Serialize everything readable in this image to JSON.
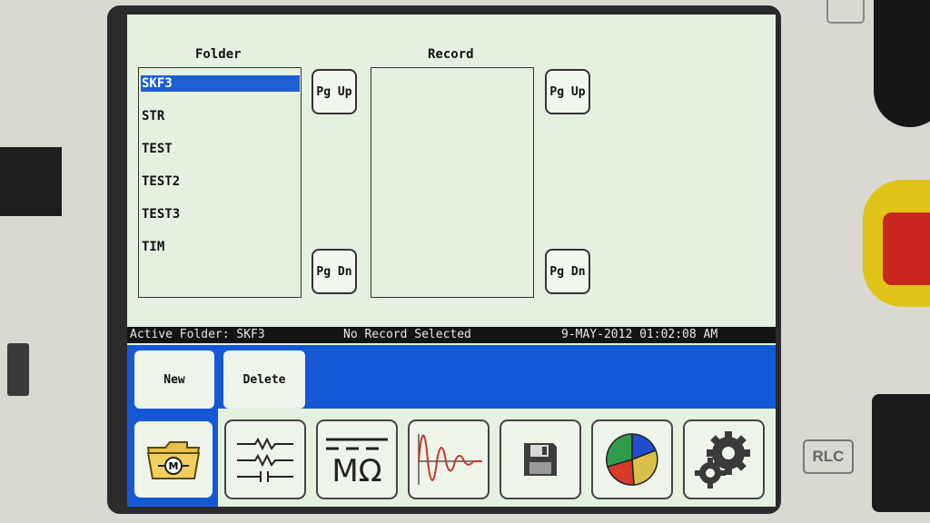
{
  "folder_panel": {
    "title": "Folder",
    "items": [
      "SKF3",
      "STR",
      "TEST",
      "TEST2",
      "TEST3",
      "TIM"
    ],
    "selected": "SKF3"
  },
  "record_panel": {
    "title": "Record"
  },
  "paging": {
    "up_label": "Pg Up",
    "down_label": "Pg Dn"
  },
  "status": {
    "active_folder": "Active Folder: SKF3",
    "record": "No Record Selected",
    "datetime": "9-MAY-2012 01:02:08 AM"
  },
  "actions": {
    "new_label": "New",
    "delete_label": "Delete"
  },
  "nav": {
    "items": [
      "folder-motor-icon",
      "resistor-network-icon",
      "megohm-icon",
      "damped-waveform-icon",
      "floppy-disk-icon",
      "pie-chart-icon",
      "gears-icon"
    ],
    "megohm_text": "MΩ"
  },
  "device": {
    "side_label": "RLC"
  },
  "colors": {
    "accent": "#1558d6",
    "screen": "#e4f1df",
    "statusbar": "#141414"
  }
}
